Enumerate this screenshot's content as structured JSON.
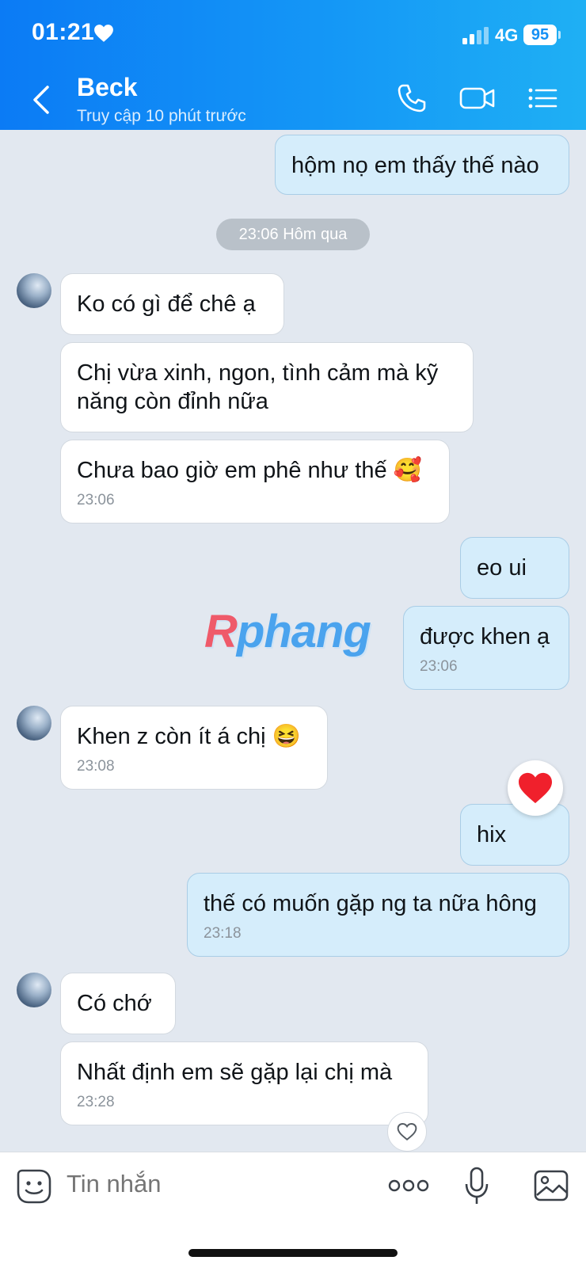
{
  "status_bar": {
    "time": "01:21",
    "network": "4G",
    "battery": "95"
  },
  "header": {
    "contact_name": "Beck",
    "last_seen": "Truy cập 10 phút trước"
  },
  "messages": [
    {
      "side": "out",
      "text": "hộm nọ em thấy thế nào"
    },
    {
      "side": "in",
      "text": "Ko có gì để chê ạ"
    },
    {
      "side": "in",
      "text": "Chị vừa xinh, ngon, tình cảm mà kỹ năng còn đỉnh nữa"
    },
    {
      "side": "in",
      "text": "Chưa bao giờ em phê như thế 🥰",
      "time": "23:06"
    },
    {
      "side": "out",
      "text": "eo ui"
    },
    {
      "side": "out",
      "text": "được khen ạ",
      "time": "23:06"
    },
    {
      "side": "in",
      "text": "Khen z còn ít á chị 😆",
      "time": "23:08"
    },
    {
      "side": "out",
      "text": "hix",
      "reaction": "heart"
    },
    {
      "side": "out",
      "text": "thế có muốn gặp ng ta nữa hông",
      "time": "23:18"
    },
    {
      "side": "in",
      "text": "Có chớ"
    },
    {
      "side": "in",
      "text": "Nhất định em sẽ gặp lại chị mà",
      "time": "23:28"
    }
  ],
  "date_separator": "23:06 Hôm qua",
  "watermark": "Rphang",
  "composer": {
    "placeholder": "Tin nhắn"
  },
  "icons": [
    "heart-icon",
    "signal-icon",
    "back-icon",
    "phone-icon",
    "video-call-icon",
    "menu-icon",
    "sticker-icon",
    "more-icon",
    "microphone-icon",
    "image-icon"
  ],
  "colors": {
    "header": "#1599f6",
    "incoming_bubble": "#ffffff",
    "outgoing_bubble": "#d5edfb",
    "background": "#e2e8f0"
  }
}
